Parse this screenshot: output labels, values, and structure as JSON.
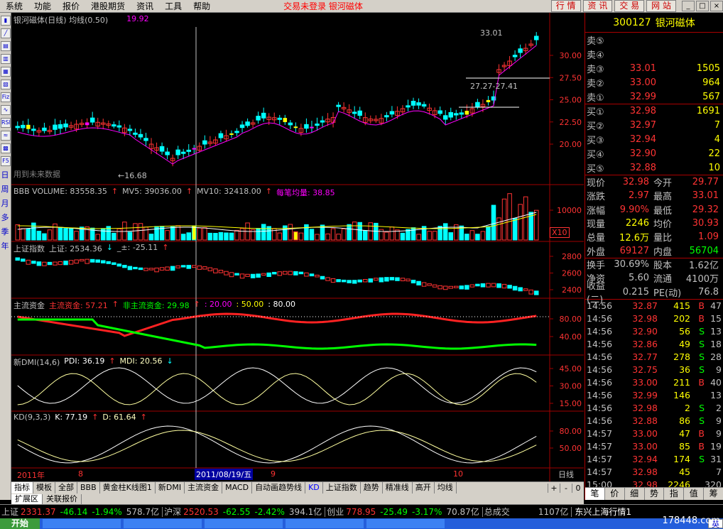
{
  "menu": {
    "items": [
      "系统",
      "功能",
      "报价",
      "港股期货",
      "资讯",
      "工具",
      "帮助"
    ],
    "status": "交易未登录  银河磁体"
  },
  "topbar": {
    "buttons": [
      "行 情",
      "资 讯",
      "交 易",
      "网 站"
    ],
    "min": "_",
    "restore": "□",
    "close": "×"
  },
  "left_tools": {
    "labels": [
      "Fiz",
      "RSI",
      "F5",
      "日",
      "周",
      "月",
      "多",
      "季",
      "年"
    ]
  },
  "chart": {
    "main": {
      "title": "银河磁体(日线) 均线(0.50)",
      "ma_value": "19.92",
      "high_label": "33.01",
      "range_label": "27.27-27.41",
      "low_label": "←16.68",
      "note": "用到未来数据",
      "yaxis": [
        "30.00",
        "27.50",
        "25.00",
        "22.50",
        "20.00"
      ]
    },
    "volume": {
      "title": "BBB VOLUME: 83558.35",
      "mv5": "MV5: 39036.00",
      "mv10": "MV10: 32418.00",
      "avg": "每笔均量: 38.85",
      "yaxis": [
        "10000"
      ],
      "unit": "X10"
    },
    "index": {
      "title": "上证指数",
      "value": "上证: 2534.36",
      "delta": "_±: -25.11",
      "yaxis": [
        "2800",
        "2600",
        "2400"
      ]
    },
    "capital": {
      "title": "主流资金",
      "main": "主流资金: 57.21",
      "nonmain": "非主流资金: 29.98",
      "l20": ": 20.00",
      "l50": ": 50.00",
      "l80": ": 80.00",
      "yaxis": [
        "80.00",
        "40.00"
      ]
    },
    "dmi": {
      "title": "新DMI(14,6)",
      "pdi": "PDI: 36.19",
      "mdi": "MDI: 20.56",
      "yaxis": [
        "45.00",
        "30.00",
        "15.00"
      ]
    },
    "kd": {
      "title": "KD(9,3,3)",
      "k": "K: 77.19",
      "d": "D: 61.64",
      "yaxis": [
        "80.00",
        "50.00"
      ]
    },
    "xaxis": {
      "labels": [
        "2011年",
        "8",
        "9",
        "10"
      ],
      "cursor_date": "2011/08/19/五",
      "period": "日线"
    }
  },
  "stock": {
    "code": "300127",
    "name": "银河磁体"
  },
  "orderbook": {
    "sells": [
      {
        "label": "卖⑤",
        "price": "",
        "vol": ""
      },
      {
        "label": "卖④",
        "price": "",
        "vol": ""
      },
      {
        "label": "卖③",
        "price": "33.01",
        "vol": "1505"
      },
      {
        "label": "卖②",
        "price": "33.00",
        "vol": "964"
      },
      {
        "label": "卖①",
        "price": "32.99",
        "vol": "567"
      }
    ],
    "buys": [
      {
        "label": "买①",
        "price": "32.98",
        "vol": "1691"
      },
      {
        "label": "买②",
        "price": "32.97",
        "vol": "7"
      },
      {
        "label": "买③",
        "price": "32.94",
        "vol": "4"
      },
      {
        "label": "买④",
        "price": "32.90",
        "vol": "22"
      },
      {
        "label": "买⑤",
        "price": "32.88",
        "vol": "10"
      }
    ]
  },
  "stats": [
    {
      "l1": "现价",
      "v1": "32.98",
      "c1": "#ff3333",
      "l2": "今开",
      "v2": "29.77",
      "c2": "#ff3333"
    },
    {
      "l1": "涨跌",
      "v1": "2.97",
      "c1": "#ff3333",
      "l2": "最高",
      "v2": "33.01",
      "c2": "#ff3333"
    },
    {
      "l1": "涨幅",
      "v1": "9.90%",
      "c1": "#ff3333",
      "l2": "最低",
      "v2": "29.32",
      "c2": "#ff3333"
    },
    {
      "l1": "现量",
      "v1": "2246",
      "c1": "#ffff00",
      "l2": "均价",
      "v2": "30.93",
      "c2": "#ff3333"
    },
    {
      "l1": "总量",
      "v1": "12.6万",
      "c1": "#ffff00",
      "l2": "量比",
      "v2": "1.09",
      "c2": "#ff3333"
    },
    {
      "l1": "外盘",
      "v1": "69127",
      "c1": "#ff3333",
      "l2": "内盘",
      "v2": "56704",
      "c2": "#00ff00"
    },
    {
      "l1": "换手",
      "v1": "30.69%",
      "c1": "#c0c0c0",
      "l2": "股本",
      "v2": "1.62亿",
      "c2": "#c0c0c0"
    },
    {
      "l1": "净资",
      "v1": "5.60",
      "c1": "#c0c0c0",
      "l2": "流通",
      "v2": "4100万",
      "c2": "#c0c0c0"
    },
    {
      "l1": "收益(二)",
      "v1": "0.215",
      "c1": "#c0c0c0",
      "l2": "PE(动)",
      "v2": "76.8",
      "c2": "#c0c0c0"
    }
  ],
  "ticks": [
    {
      "time": "14:56",
      "price": "32.87",
      "vol": "415",
      "bs": "B",
      "n": "47"
    },
    {
      "time": "14:56",
      "price": "32.98",
      "vol": "202",
      "bs": "B",
      "n": "15"
    },
    {
      "time": "14:56",
      "price": "32.90",
      "vol": "56",
      "bs": "S",
      "n": "13"
    },
    {
      "time": "14:56",
      "price": "32.86",
      "vol": "49",
      "bs": "S",
      "n": "18"
    },
    {
      "time": "14:56",
      "price": "32.77",
      "vol": "278",
      "bs": "S",
      "n": "28"
    },
    {
      "time": "14:56",
      "price": "32.75",
      "vol": "36",
      "bs": "S",
      "n": "9"
    },
    {
      "time": "14:56",
      "price": "33.00",
      "vol": "211",
      "bs": "B",
      "n": "40"
    },
    {
      "time": "14:56",
      "price": "32.99",
      "vol": "146",
      "bs": "",
      "n": "13"
    },
    {
      "time": "14:56",
      "price": "32.98",
      "vol": "2",
      "bs": "S",
      "n": "2"
    },
    {
      "time": "14:56",
      "price": "32.88",
      "vol": "86",
      "bs": "S",
      "n": "9"
    },
    {
      "time": "14:57",
      "price": "33.00",
      "vol": "47",
      "bs": "B",
      "n": "9"
    },
    {
      "time": "14:57",
      "price": "33.00",
      "vol": "85",
      "bs": "B",
      "n": "19"
    },
    {
      "time": "14:57",
      "price": "32.94",
      "vol": "174",
      "bs": "S",
      "n": "31"
    },
    {
      "time": "14:57",
      "price": "32.98",
      "vol": "45",
      "bs": "",
      "n": "7"
    },
    {
      "time": "15:00",
      "price": "32.98",
      "vol": "2246",
      "bs": "",
      "n": "320"
    }
  ],
  "right_tabs": [
    "笔",
    "价",
    "细",
    "势",
    "指",
    "值",
    "筹"
  ],
  "tabs1": [
    "指标",
    "模板",
    "全部",
    "BBB",
    "黄金柱K线图1",
    "新DMI",
    "主流资金",
    "MACD",
    "自动画趋势线",
    "KD",
    "上证指数",
    "趋势",
    "精准线",
    "高开",
    "均线"
  ],
  "tabs1_ctl": [
    "+",
    "-",
    "0"
  ],
  "tabs2": [
    "扩展区",
    "关联报价"
  ],
  "ticker": [
    {
      "name": "上证",
      "v": "2331.37",
      "d": "-46.14",
      "p": "-1.94%",
      "amt": "578.7亿"
    },
    {
      "name": "沪深",
      "v": "2520.53",
      "d": "-62.55",
      "p": "-2.42%",
      "amt": "394.1亿"
    },
    {
      "name": "创业",
      "v": "778.95",
      "d": "-25.49",
      "p": "-3.17%",
      "amt": "70.87亿"
    }
  ],
  "ticker_extra": {
    "label": "总成交",
    "amt": "1107亿",
    "broker": "东兴上海行情1"
  },
  "taskbar": {
    "start": "开始",
    "ime": "英"
  },
  "watermark": "178448.com",
  "colors": {
    "up": "#ff3333",
    "down": "#00ffff",
    "magenta": "#ff00ff",
    "yellow": "#ffff00",
    "green": "#00ff00"
  }
}
